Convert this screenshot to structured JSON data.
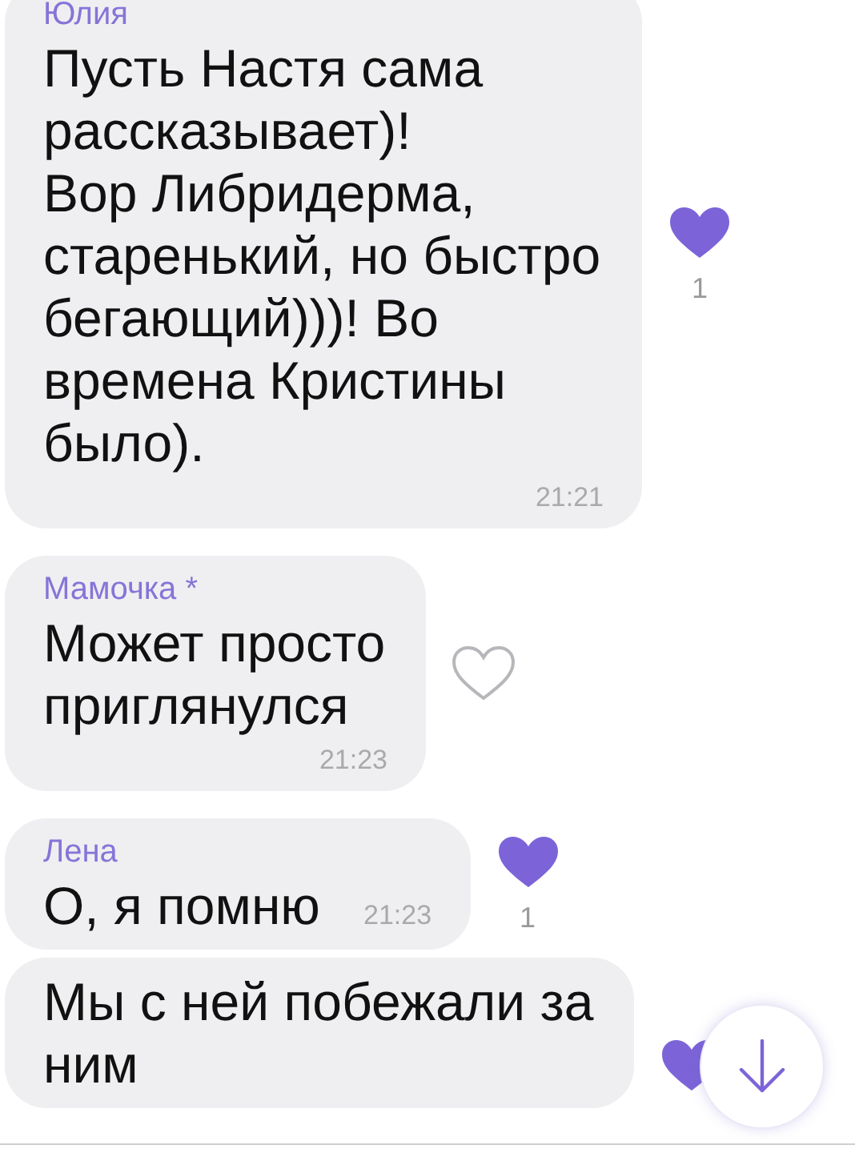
{
  "messages": [
    {
      "sender": "Юлия",
      "text": "Пусть Настя сама рассказывает)!\nВор Либридерма, старенький, но быстро бегающий)))! Во времена Кристины было).",
      "time": "21:21",
      "kind": "block",
      "liked": true,
      "like_count": "1"
    },
    {
      "sender": "Мамочка *",
      "text": "Может просто приглянулся",
      "time": "21:23",
      "kind": "block",
      "liked": false
    },
    {
      "sender": "Лена",
      "text": "О, я помню",
      "time": "21:23",
      "kind": "inline",
      "liked": true,
      "like_count": "1"
    },
    {
      "text": "Мы с ней побежали за ним",
      "kind": "block",
      "liked": true
    }
  ],
  "scroll_down_button": {
    "visible": true
  }
}
